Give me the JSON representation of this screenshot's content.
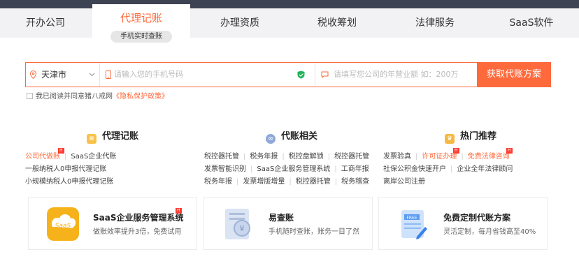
{
  "tabs": [
    {
      "label": "开办公司"
    },
    {
      "label": "代理记账",
      "sub": "手机实时查账"
    },
    {
      "label": "办理资质"
    },
    {
      "label": "税收筹划"
    },
    {
      "label": "法律服务"
    },
    {
      "label": "SaaS软件"
    }
  ],
  "form": {
    "city": "天津市",
    "phone_placeholder": "请输入您的手机号码",
    "revenue_placeholder": "请填写您公司的年营业额 如：200万",
    "submit": "获取代账方案"
  },
  "agreement": {
    "text": "我已阅读并同意猪八戒网",
    "link": "《隐私保护政策》"
  },
  "columns": [
    {
      "title": "代理记账",
      "rows": [
        [
          {
            "t": "公司代做账",
            "hot": true
          },
          {
            "t": "SaaS企业代账"
          }
        ],
        [
          {
            "t": "一般纳税人0申报代理记账"
          }
        ],
        [
          {
            "t": "小规模纳税人0申报代理记账"
          }
        ]
      ]
    },
    {
      "title": "代账相关",
      "rows": [
        [
          {
            "t": "税控器托管"
          },
          {
            "t": "税务年报"
          },
          {
            "t": "税控盘解锁"
          },
          {
            "t": "税控器托管"
          }
        ],
        [
          {
            "t": "发票智能识别"
          },
          {
            "t": "SaaS企业服务管理系统"
          },
          {
            "t": "工商年报"
          }
        ],
        [
          {
            "t": "税务年报"
          },
          {
            "t": "发票增版增量"
          },
          {
            "t": "税控器托管"
          },
          {
            "t": "税务稽查"
          }
        ]
      ]
    },
    {
      "title": "热门推荐",
      "rows": [
        [
          {
            "t": "发票验真"
          },
          {
            "t": "许可证办理",
            "hot": true
          },
          {
            "t": "免费法律咨询",
            "hot": true
          }
        ],
        [
          {
            "t": "社保公积金快速开户"
          },
          {
            "t": "企业全年法律顾问"
          }
        ],
        [
          {
            "t": "离岸公司注册"
          }
        ]
      ]
    }
  ],
  "hot_label": "H",
  "cards": [
    {
      "title": "SaaS企业服务管理系统",
      "desc": "做账效率提升3倍，免费试用",
      "hot": true
    },
    {
      "title": "易查账",
      "desc": "手机随时查账，账务一目了然"
    },
    {
      "title": "免费定制代账方案",
      "desc": "灵活定制，每月省钱高至40%"
    }
  ],
  "icons": {
    "location": "location-pin-icon",
    "phone": "phone-icon",
    "shield": "shield-check-icon",
    "chat": "chat-icon"
  },
  "colors": {
    "accent": "#ff6a3d",
    "hot": "#ff3b30",
    "topbar": "#3d4352",
    "tabs_bg": "#f2f2f4"
  }
}
